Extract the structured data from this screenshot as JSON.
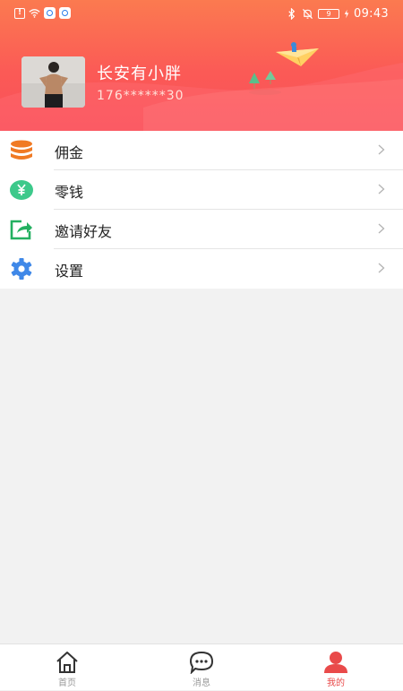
{
  "status_bar": {
    "time": "09:43",
    "battery": "9"
  },
  "profile": {
    "name": "长安有小胖",
    "phone": "176******30"
  },
  "menu": {
    "items": [
      {
        "label": "佣金",
        "icon": "coins-stack-icon",
        "color": "#f07a24"
      },
      {
        "label": "零钱",
        "icon": "yen-coin-icon",
        "color": "#3dc98b"
      },
      {
        "label": "邀请好友",
        "icon": "share-icon",
        "color": "#24b061"
      },
      {
        "label": "设置",
        "icon": "gear-icon",
        "color": "#3f88e8"
      }
    ]
  },
  "bottom_nav": {
    "tabs": [
      {
        "label": "首页",
        "icon": "home-icon",
        "active": false
      },
      {
        "label": "消息",
        "icon": "message-icon",
        "active": false
      },
      {
        "label": "我的",
        "icon": "profile-icon",
        "active": true
      }
    ]
  },
  "colors": {
    "header_start": "#fb7a50",
    "header_end": "#f9505a",
    "active_tab": "#e94a4a",
    "page_background": "#f2f2f2"
  }
}
